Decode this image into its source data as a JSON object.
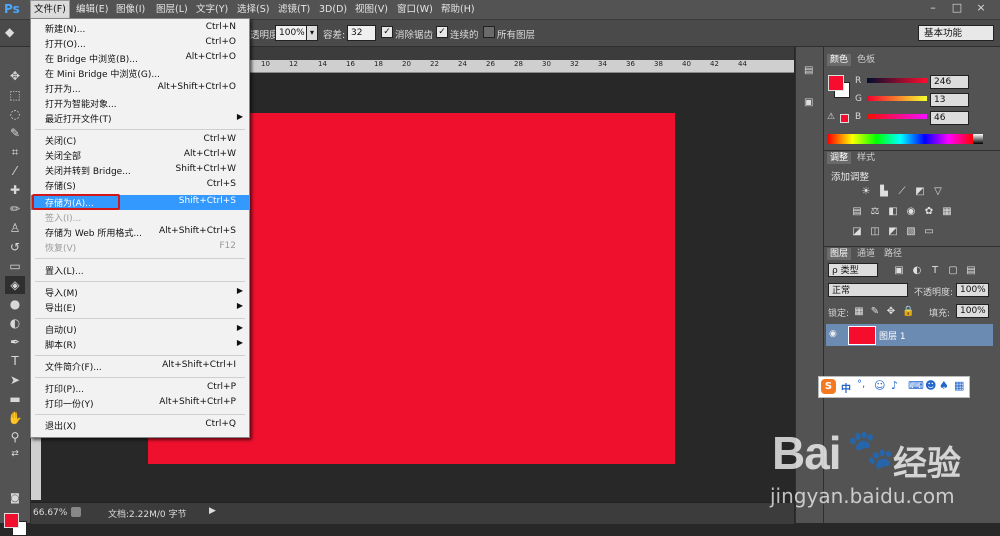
{
  "app": {
    "logo": "Ps"
  },
  "menubar": {
    "items": [
      "文件(F)",
      "编辑(E)",
      "图像(I)",
      "图层(L)",
      "文字(Y)",
      "选择(S)",
      "滤镜(T)",
      "3D(D)",
      "视图(V)",
      "窗口(W)",
      "帮助(H)"
    ],
    "window_buttons": [
      "–",
      "□",
      "×"
    ]
  },
  "options_bar": {
    "opacity_label": "透明度:",
    "opacity_value": "100%",
    "tolerance_label": "容差:",
    "tolerance_value": "32",
    "antialias_label": "消除锯齿",
    "contiguous_label": "连续的",
    "all_layers_label": "所有图层",
    "workspace": "基本功能"
  },
  "file_menu": {
    "items": [
      {
        "label": "新建(N)...",
        "shortcut": "Ctrl+N"
      },
      {
        "label": "打开(O)...",
        "shortcut": "Ctrl+O"
      },
      {
        "label": "在 Bridge 中浏览(B)...",
        "shortcut": "Alt+Ctrl+O"
      },
      {
        "label": "在 Mini Bridge 中浏览(G)...",
        "shortcut": ""
      },
      {
        "label": "打开为...",
        "shortcut": "Alt+Shift+Ctrl+O"
      },
      {
        "label": "打开为智能对象...",
        "shortcut": ""
      },
      {
        "label": "最近打开文件(T)",
        "shortcut": ""
      },
      {
        "label": "关闭(C)",
        "shortcut": "Ctrl+W"
      },
      {
        "label": "关闭全部",
        "shortcut": "Alt+Ctrl+W"
      },
      {
        "label": "关闭并转到 Bridge...",
        "shortcut": "Shift+Ctrl+W"
      },
      {
        "label": "存储(S)",
        "shortcut": "Ctrl+S"
      },
      {
        "label": "存储为(A)...",
        "shortcut": "Shift+Ctrl+S"
      },
      {
        "label": "签入(I)...",
        "shortcut": ""
      },
      {
        "label": "存储为 Web 所用格式...",
        "shortcut": "Alt+Shift+Ctrl+S"
      },
      {
        "label": "恢复(V)",
        "shortcut": "F12"
      },
      {
        "label": "置入(L)...",
        "shortcut": ""
      },
      {
        "label": "导入(M)",
        "shortcut": ""
      },
      {
        "label": "导出(E)",
        "shortcut": ""
      },
      {
        "label": "自动(U)",
        "shortcut": ""
      },
      {
        "label": "脚本(R)",
        "shortcut": ""
      },
      {
        "label": "文件简介(F)...",
        "shortcut": "Alt+Shift+Ctrl+I"
      },
      {
        "label": "打印(P)...",
        "shortcut": "Ctrl+P"
      },
      {
        "label": "打印一份(Y)",
        "shortcut": "Alt+Shift+Ctrl+P"
      },
      {
        "label": "退出(X)",
        "shortcut": "Ctrl+Q"
      }
    ]
  },
  "ruler": {
    "ticks": [
      "10",
      "12",
      "14",
      "16",
      "18",
      "20",
      "22",
      "24",
      "26",
      "28",
      "30",
      "32",
      "34",
      "36",
      "38",
      "40",
      "42",
      "44"
    ]
  },
  "status_bar": {
    "zoom": "66.67%",
    "doc_info": "文档:2.22M/0 字节"
  },
  "color_panel": {
    "tabs": [
      "颜色",
      "色板"
    ],
    "channels": [
      {
        "label": "R",
        "value": "246"
      },
      {
        "label": "G",
        "value": "13"
      },
      {
        "label": "B",
        "value": "46"
      }
    ],
    "foreground": "#f60d2e"
  },
  "adjustments_panel": {
    "tabs": [
      "调整",
      "样式"
    ],
    "title": "添加调整"
  },
  "layers_panel": {
    "tabs": [
      "图层",
      "通道",
      "路径"
    ],
    "filter_label": "ρ 类型",
    "blend_mode": "正常",
    "opacity_label": "不透明度:",
    "opacity_value": "100%",
    "lock_label": "锁定:",
    "fill_label": "填充:",
    "fill_value": "100%",
    "layer_name": "图层 1"
  },
  "ime_bar": {
    "label": "中"
  },
  "watermark": {
    "brand": "Bai",
    "brand_cn": "经验",
    "url": "jingyan.baidu.com"
  }
}
